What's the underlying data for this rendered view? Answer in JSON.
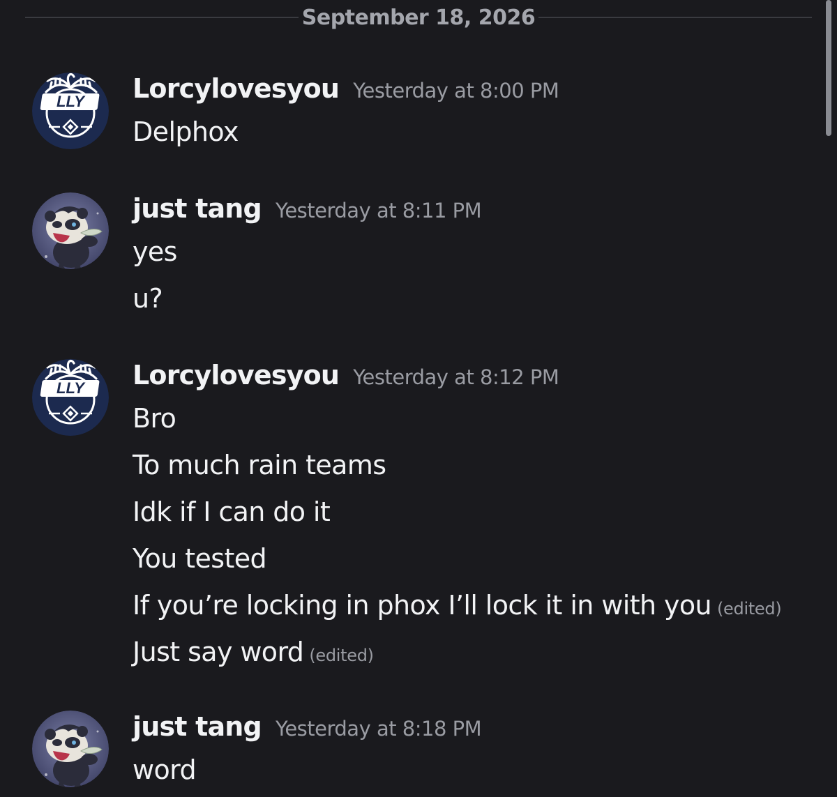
{
  "date_divider": "September 18, 2026",
  "messages": [
    {
      "username": "Lorcylovesyou",
      "timestamp": "Yesterday at 8:00 PM",
      "avatar": "lly-logo-avatar",
      "lines": [
        {
          "text": "Delphox",
          "edited": ""
        }
      ]
    },
    {
      "username": "just tang",
      "timestamp": "Yesterday at 8:11 PM",
      "avatar": "pangoro-avatar",
      "lines": [
        {
          "text": "yes",
          "edited": ""
        },
        {
          "text": "u?",
          "edited": ""
        }
      ]
    },
    {
      "username": "Lorcylovesyou",
      "timestamp": "Yesterday at 8:12 PM",
      "avatar": "lly-logo-avatar",
      "lines": [
        {
          "text": "Bro",
          "edited": ""
        },
        {
          "text": "To much rain teams",
          "edited": ""
        },
        {
          "text": "Idk if I can do it",
          "edited": ""
        },
        {
          "text": "You tested",
          "edited": ""
        },
        {
          "text": "If you’re locking in phox I’ll lock it in with you",
          "edited": "(edited)"
        },
        {
          "text": "Just say word",
          "edited": "(edited)"
        }
      ]
    },
    {
      "username": "just tang",
      "timestamp": "Yesterday at 8:18 PM",
      "avatar": "pangoro-avatar",
      "lines": [
        {
          "text": "word",
          "edited": ""
        }
      ]
    }
  ],
  "avatar_logo_text": "LLY",
  "colors": {
    "background": "#1a1a1e",
    "text": "#f2f3f5",
    "muted": "#9a9ca3",
    "avatar_navy": "#1c2a4f"
  }
}
